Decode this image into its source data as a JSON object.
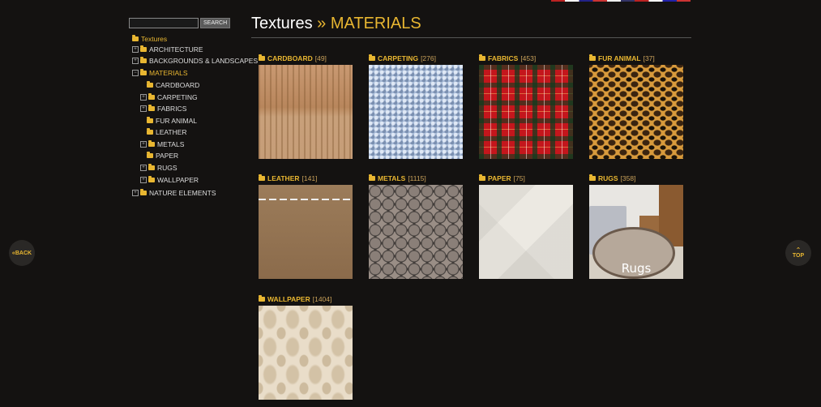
{
  "search": {
    "value": "",
    "button_label": "SEARCH"
  },
  "tree": {
    "root": "Textures",
    "items": [
      {
        "label": "ARCHITECTURE"
      },
      {
        "label": "BACKGROUNDS & LANDSCAPES"
      },
      {
        "label": "MATERIALS"
      },
      {
        "label": "CARDBOARD"
      },
      {
        "label": "CARPETING"
      },
      {
        "label": "FABRICS"
      },
      {
        "label": "FUR ANIMAL"
      },
      {
        "label": "LEATHER"
      },
      {
        "label": "METALS"
      },
      {
        "label": "PAPER"
      },
      {
        "label": "RUGS"
      },
      {
        "label": "WALLPAPER"
      },
      {
        "label": "NATURE ELEMENTS"
      }
    ]
  },
  "header": {
    "root": "Textures",
    "separator": "»",
    "current": "MATERIALS"
  },
  "categories": [
    {
      "name": "CARDBOARD",
      "count": "[49]"
    },
    {
      "name": "CARPETING",
      "count": "[276]"
    },
    {
      "name": "FABRICS",
      "count": "[453]"
    },
    {
      "name": "FUR ANIMAL",
      "count": "[37]"
    },
    {
      "name": "LEATHER",
      "count": "[141]"
    },
    {
      "name": "METALS",
      "count": "[1115]"
    },
    {
      "name": "PAPER",
      "count": "[75]"
    },
    {
      "name": "RUGS",
      "count": "[358]",
      "thumb_text": "Rugs"
    },
    {
      "name": "WALLPAPER",
      "count": "[1404]"
    }
  ],
  "nav": {
    "back_label": "BACK",
    "top_label": "TOP"
  },
  "colors": {
    "accent": "#e8b631",
    "background": "#141211"
  }
}
